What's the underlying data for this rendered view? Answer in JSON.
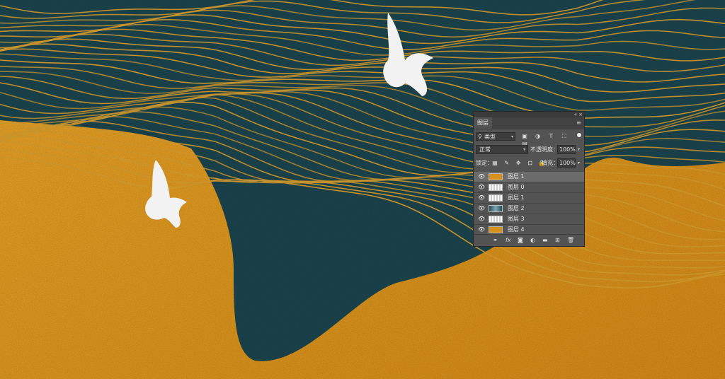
{
  "panel": {
    "tab": "图层",
    "filter": {
      "kind": "类型",
      "icons": [
        "image-filter-icon",
        "adjustment-filter-icon",
        "type-filter-icon",
        "shape-filter-icon",
        "smart-object-filter-icon"
      ]
    },
    "blend_mode": "正常",
    "opacity_label": "不透明度：",
    "opacity_value": "100%",
    "lock_label": "锁定：",
    "fill_label": "填充：",
    "fill_value": "100%",
    "layers": [
      {
        "name": "图层 1",
        "thumb": "gold",
        "selected": true
      },
      {
        "name": "图层 0",
        "thumb": "bird",
        "selected": false
      },
      {
        "name": "图层 1",
        "thumb": "bird",
        "selected": false
      },
      {
        "name": "图层 2",
        "thumb": "teal",
        "selected": false
      },
      {
        "name": "图层 3",
        "thumb": "bird",
        "selected": false
      },
      {
        "name": "图层 4",
        "thumb": "gold",
        "selected": false
      }
    ],
    "bottom_icons": [
      "link-icon",
      "fx-icon",
      "mask-icon",
      "adjustment-icon",
      "folder-icon",
      "new-layer-icon",
      "trash-icon"
    ]
  },
  "colors": {
    "panel_bg": "#535353",
    "gold": "#e29a1f",
    "teal": "#1c4650",
    "gold_line": "#c9942c"
  }
}
